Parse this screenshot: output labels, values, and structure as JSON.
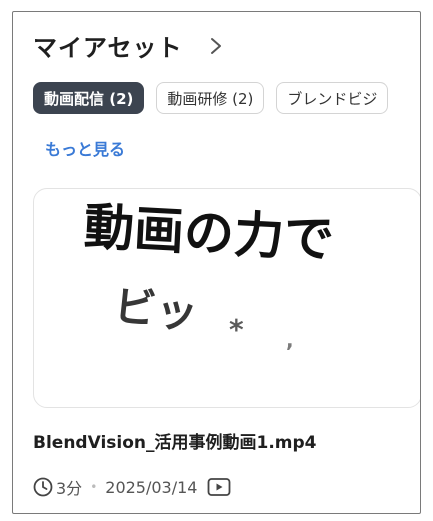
{
  "section": {
    "title": "マイアセット",
    "chevron_icon": "chevron-right-icon"
  },
  "tabs": [
    {
      "label": "動画配信 (2)",
      "active": true
    },
    {
      "label": "動画研修 (2)",
      "active": false
    },
    {
      "label": "ブレンドビジ",
      "active": false
    }
  ],
  "more_link": "もっと見る",
  "asset": {
    "thumbnail_line1": "動画の力で",
    "thumbnail_line2": "ビッ",
    "title": "BlendVision_活用事例動画1.mp4",
    "duration": "3分",
    "date": "2025/03/14",
    "type_icon": "play-video-icon",
    "time_icon": "clock-icon"
  },
  "colors": {
    "active_tab_bg": "#3c4450",
    "link": "#3a7ad6"
  }
}
